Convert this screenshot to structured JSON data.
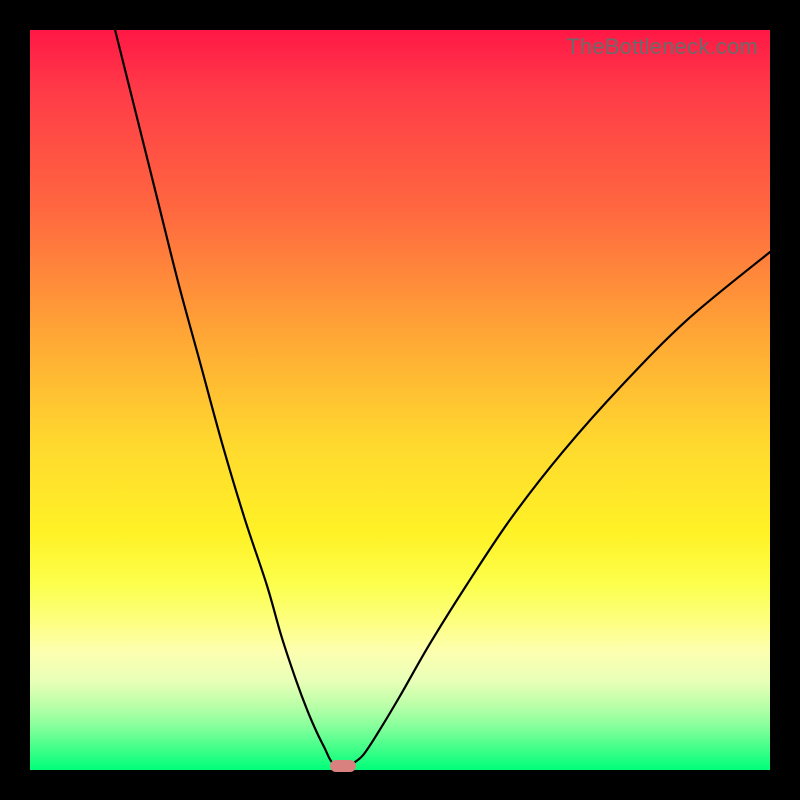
{
  "watermark": "TheBottleneck.com",
  "chart_data": {
    "type": "line",
    "title": "",
    "xlabel": "",
    "ylabel": "",
    "xlim": [
      0,
      100
    ],
    "ylim": [
      0,
      100
    ],
    "background_gradient": {
      "top": "#ff1846",
      "bottom": "#00ff7a"
    },
    "series": [
      {
        "name": "left-branch",
        "x": [
          11.5,
          14,
          17,
          20,
          23,
          26,
          29,
          32,
          34,
          36,
          37.5,
          38.8,
          39.8,
          40.5,
          41
        ],
        "values": [
          100,
          90,
          78,
          66,
          55,
          44,
          34,
          25,
          18,
          12,
          8,
          5,
          3,
          1.5,
          0.8
        ]
      },
      {
        "name": "right-branch",
        "x": [
          43.5,
          45,
          47,
          50,
          54,
          59,
          65,
          72,
          80,
          89,
          100
        ],
        "values": [
          0.8,
          2,
          5,
          10,
          17,
          25,
          34,
          43,
          52,
          61,
          70
        ]
      }
    ],
    "marker": {
      "x": 42.3,
      "y": 0.5,
      "color": "#d9817e"
    }
  }
}
